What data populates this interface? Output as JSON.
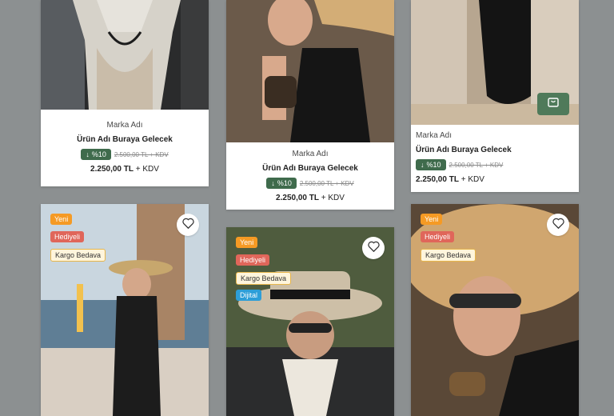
{
  "products": [
    {
      "brand": "Marka Adı",
      "name": "Ürün Adı Buraya Gelecek",
      "discount": "%10",
      "old_price": "2.500,00 TL + KDV",
      "price": "2.250,00 TL",
      "price_suffix": "+ KDV"
    },
    {
      "brand": "Marka Adı",
      "name": "Ürün Adı Buraya Gelecek",
      "discount": "%10",
      "old_price": "2.500,00 TL + KDV",
      "price": "2.250,00 TL",
      "price_suffix": "+ KDV"
    },
    {
      "brand": "Marka Adı",
      "name": "Ürün Adı Buraya Gelecek",
      "discount": "%10",
      "old_price": "2.500,00 TL + KDV",
      "price": "2.250,00 TL",
      "price_suffix": "+ KDV"
    }
  ],
  "badges": {
    "yeni": "Yeni",
    "hediyeli": "Hediyeli",
    "kargo": "Kargo Bedava",
    "dijital": "Dijital"
  },
  "icons": {
    "heart": "heart-icon",
    "cart": "shopping-bag-icon",
    "arrow": "arrow-down-icon"
  },
  "colors": {
    "background": "#8c9091",
    "discount": "#3f6b4c",
    "cart": "#4f7a5a",
    "badge_yeni": "#f59a24",
    "badge_hediyeli": "#e0665a",
    "badge_dijital": "#2d9ed8"
  }
}
